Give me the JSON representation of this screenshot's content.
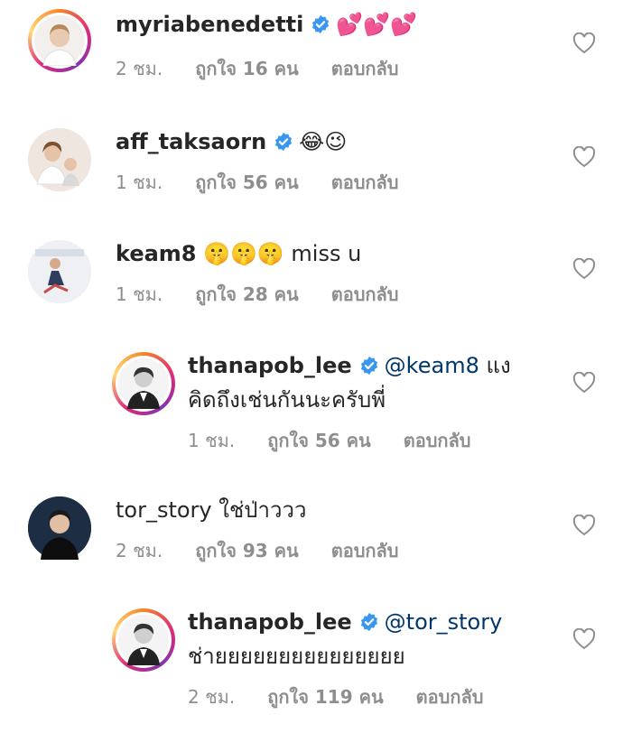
{
  "comments": [
    {
      "username": "myriabenedetti",
      "verified": true,
      "text": "💕💕💕",
      "time": "2 ชม.",
      "likes": "ถูกใจ 16 คน",
      "reply": "ตอบกลับ",
      "avatar": "person-avatar-woman-white"
    },
    {
      "username": "aff_taksaorn",
      "verified": true,
      "text": "😂😉",
      "time": "1 ชม.",
      "likes": "ถูกใจ 56 คน",
      "reply": "ตอบกลับ",
      "avatar": "person-avatar-woman-child"
    },
    {
      "username": "keam8",
      "verified": false,
      "text": "🤫🤫🤫 miss u",
      "time": "1 ชม.",
      "likes": "ถูกใจ 28 คน",
      "reply": "ตอบกลับ",
      "avatar": "person-avatar-outdoor"
    },
    {
      "username": "thanapob_lee",
      "verified": true,
      "mention": "@keam8",
      "text": " แง",
      "text2": "คิดถึงเช่นกันนะครับพี่",
      "time": "1 ชม.",
      "likes": "ถูกใจ 56 คน",
      "reply": "ตอบกลับ",
      "avatar": "person-avatar-man-bw"
    },
    {
      "username": "tor_story",
      "verified": false,
      "text": "ใช่ป่าววว",
      "time": "2 ชม.",
      "likes": "ถูกใจ 93 คน",
      "reply": "ตอบกลับ",
      "avatar": "person-avatar-man-dark"
    },
    {
      "username": "thanapob_lee",
      "verified": true,
      "mention": "@tor_story",
      "text": "",
      "text2": "ช่ายยยยยยยยยยยยยยย",
      "time": "2 ชม.",
      "likes": "ถูกใจ 119 คน",
      "reply": "ตอบกลับ",
      "avatar": "person-avatar-man-bw"
    }
  ],
  "colors": {
    "username": "#262626",
    "mention": "#00376b",
    "meta": "#8e8e8e",
    "verified": "#3897f0"
  }
}
